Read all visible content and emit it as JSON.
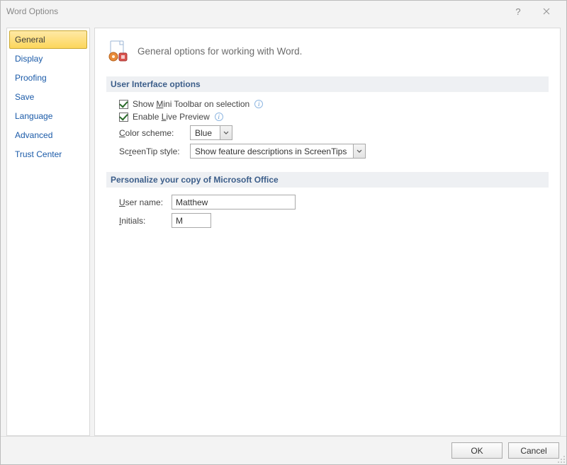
{
  "window": {
    "title": "Word Options"
  },
  "sidebar": {
    "items": [
      {
        "label": "General",
        "selected": true
      },
      {
        "label": "Display",
        "selected": false
      },
      {
        "label": "Proofing",
        "selected": false
      },
      {
        "label": "Save",
        "selected": false
      },
      {
        "label": "Language",
        "selected": false
      },
      {
        "label": "Advanced",
        "selected": false
      },
      {
        "label": "Trust Center",
        "selected": false
      }
    ]
  },
  "page": {
    "header_text": "General options for working with Word."
  },
  "section1": {
    "title": "User Interface options",
    "mini_toolbar": {
      "pre": "Show ",
      "u": "M",
      "post": "ini Toolbar on selection",
      "checked": true
    },
    "live_preview": {
      "pre": "Enable ",
      "u": "L",
      "post": "ive Preview",
      "checked": true
    },
    "color_scheme": {
      "label_pre": "",
      "label_u": "C",
      "label_post": "olor scheme:",
      "value": "Blue"
    },
    "screentip": {
      "label_pre": "Sc",
      "label_u": "r",
      "label_post": "eenTip style:",
      "value": "Show feature descriptions in ScreenTips"
    }
  },
  "section2": {
    "title": "Personalize your copy of Microsoft Office",
    "username": {
      "label_u": "U",
      "label_post": "ser name:",
      "value": "Matthew"
    },
    "initials": {
      "label_u": "I",
      "label_post": "nitials:",
      "value": "M"
    }
  },
  "footer": {
    "ok": "OK",
    "cancel": "Cancel"
  }
}
